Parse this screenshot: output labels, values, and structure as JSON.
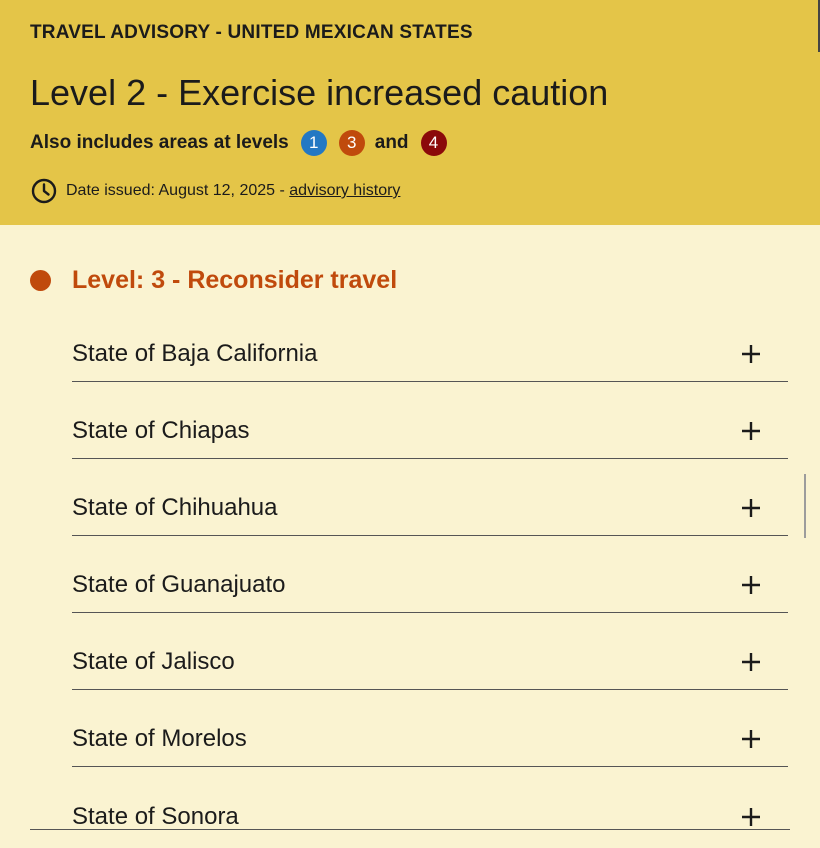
{
  "colors": {
    "header_bg": "#e4c548",
    "page_bg": "#faf3d1",
    "level1": "#2378c3",
    "level3": "#c04a0c",
    "level4": "#8b0a0a"
  },
  "header": {
    "eyebrow": "TRAVEL ADVISORY - UNITED MEXICAN STATES",
    "title": "Level 2 - Exercise increased caution",
    "also_label": "Also includes areas at levels",
    "badges": [
      "1",
      "3",
      "4"
    ],
    "and_word": "and",
    "date_text": "Date issued: August 12, 2025 - ",
    "history_link": "advisory history",
    "clock_icon": "clock-icon"
  },
  "section": {
    "heading": "Level: 3 - Reconsider travel",
    "items": [
      {
        "label": "State of Baja California",
        "icon": "plus-icon"
      },
      {
        "label": "State of Chiapas",
        "icon": "plus-icon"
      },
      {
        "label": "State of Chihuahua",
        "icon": "plus-icon"
      },
      {
        "label": "State of Guanajuato",
        "icon": "plus-icon"
      },
      {
        "label": "State of Jalisco",
        "icon": "plus-icon"
      },
      {
        "label": "State of Morelos",
        "icon": "plus-icon"
      },
      {
        "label": "State of Sonora",
        "icon": "plus-icon"
      }
    ]
  }
}
